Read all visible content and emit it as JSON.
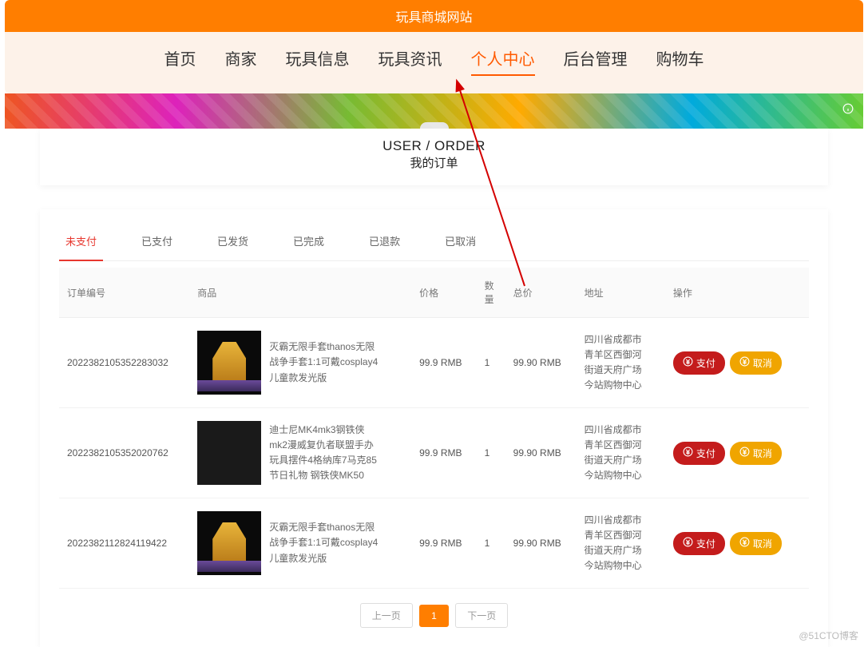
{
  "site_title": "玩具商城网站",
  "nav": {
    "items": [
      {
        "label": "首页",
        "active": false
      },
      {
        "label": "商家",
        "active": false
      },
      {
        "label": "玩具信息",
        "active": false
      },
      {
        "label": "玩具资讯",
        "active": false
      },
      {
        "label": "个人中心",
        "active": true
      },
      {
        "label": "后台管理",
        "active": false
      },
      {
        "label": "购物车",
        "active": false
      }
    ]
  },
  "page_header": {
    "en": "USER / ORDER",
    "zh": "我的订单"
  },
  "tabs": {
    "items": [
      {
        "label": "未支付",
        "active": true
      },
      {
        "label": "已支付",
        "active": false
      },
      {
        "label": "已发货",
        "active": false
      },
      {
        "label": "已完成",
        "active": false
      },
      {
        "label": "已退款",
        "active": false
      },
      {
        "label": "已取消",
        "active": false
      }
    ]
  },
  "table": {
    "headers": {
      "order_no": "订单编号",
      "product": "商品",
      "price": "价格",
      "qty": "数量",
      "total": "总价",
      "address": "地址",
      "actions": "操作"
    }
  },
  "orders": [
    {
      "order_no": "2022382105352283032",
      "img_kind": "gauntlet",
      "product": "灭霸无限手套thanos无限战争手套1:1可戴cosplay4 儿童款发光版",
      "price": "99.9 RMB",
      "qty": "1",
      "total": "99.90 RMB",
      "address": "四川省成都市青羊区西御河街道天府广场今站购物中心"
    },
    {
      "order_no": "2022382105352020762",
      "img_kind": "ironman",
      "product": "迪士尼MK4mk3钢铁侠mk2漫威复仇者联盟手办玩具摆件4格纳库7马克85节日礼物 钢铁侠MK50",
      "price": "99.9 RMB",
      "qty": "1",
      "total": "99.90 RMB",
      "address": "四川省成都市青羊区西御河街道天府广场今站购物中心"
    },
    {
      "order_no": "2022382112824119422",
      "img_kind": "gauntlet",
      "product": "灭霸无限手套thanos无限战争手套1:1可戴cosplay4 儿童款发光版",
      "price": "99.9 RMB",
      "qty": "1",
      "total": "99.90 RMB",
      "address": "四川省成都市青羊区西御河街道天府广场今站购物中心"
    }
  ],
  "action_labels": {
    "pay": "支付",
    "cancel": "取消"
  },
  "pager": {
    "prev": "上一页",
    "current": "1",
    "next": "下一页"
  },
  "watermark": "@51CTO博客"
}
